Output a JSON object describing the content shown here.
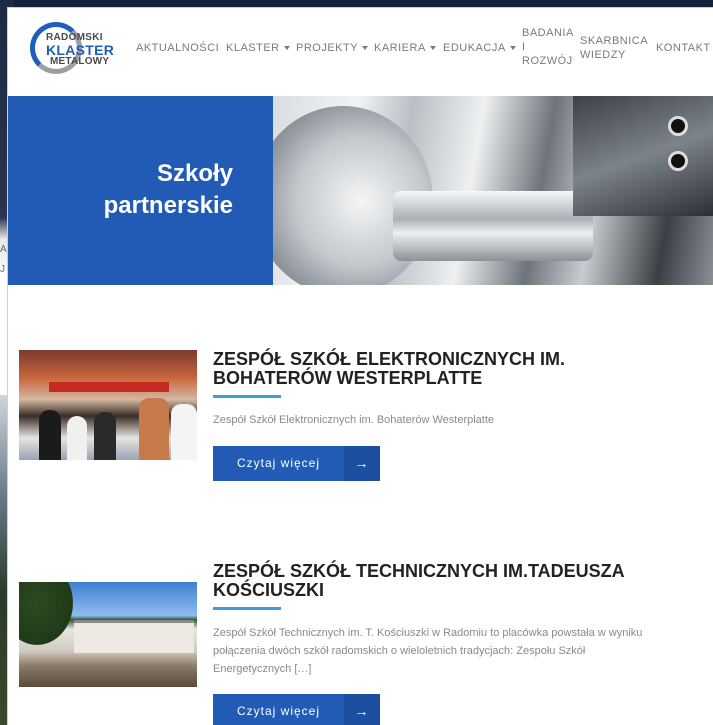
{
  "logo": {
    "line1": "RADOMSKI",
    "line2": "KLASTER",
    "line3": "METALOWY"
  },
  "nav": {
    "items": [
      {
        "label": "AKTUALNOŚCI"
      },
      {
        "label": "KLASTER"
      },
      {
        "label": "PROJEKTY"
      },
      {
        "label": "KARIERA"
      },
      {
        "label": "EDUKACJA"
      }
    ],
    "badania": {
      "line1": "BADANIA",
      "line2": "I",
      "line3": "ROZWÓJ"
    },
    "skarbnica": {
      "line1": "SKARBNICA",
      "line2": "WIEDZY"
    },
    "kontakt": "KONTAKT"
  },
  "hero": {
    "title_line1": "Szkoły",
    "title_line2": "partnerskie"
  },
  "schools": [
    {
      "title": "ZESPÓŁ SZKÓŁ ELEKTRONICZNYCH IM. BOHATERÓW WESTERPLATTE",
      "description": "Zespół Szkół Elektronicznych im. Bohaterów Westerplatte",
      "button": "Czytaj więcej"
    },
    {
      "title": "ZESPÓŁ SZKÓŁ TECHNICZNYCH IM.TADEUSZA KOŚCIUSZKI",
      "description": "Zespół Szkół Technicznych im. T. Kościuszki w Radomiu to placówka powstała w wyniku połączenia dwóch szkół radomskich o wieloletnich tradycjach: Zespołu Szkół Energetycznych […]",
      "button": "Czytaj więcej"
    }
  ],
  "background": {
    "text1": "A",
    "text2": "J"
  },
  "colors": {
    "primary": "#225bb6",
    "accent": "#34a1da",
    "text_muted": "#8a8a8a"
  }
}
